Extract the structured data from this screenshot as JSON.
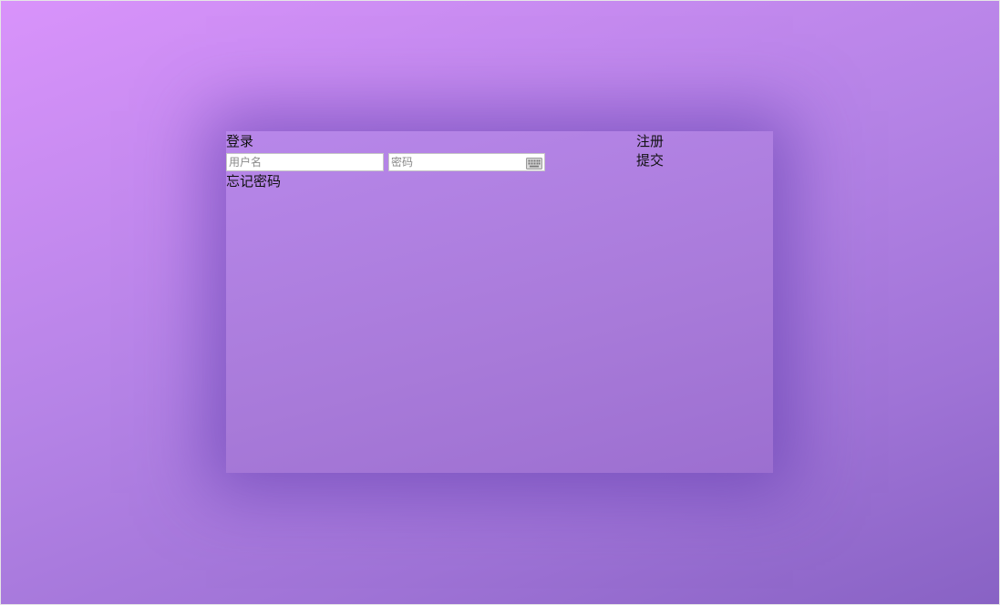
{
  "login": {
    "title": "登录",
    "username_placeholder": "用户名",
    "password_placeholder": "密码",
    "register_label": "注册",
    "submit_label": "提交",
    "forgot_password_label": "忘记密码",
    "keyboard_icon": "keyboard-icon"
  },
  "colors": {
    "background_start": "#d993fb",
    "background_end": "#8862c4",
    "panel": "#b887ea",
    "panel_shadow": "#5a37aa"
  }
}
